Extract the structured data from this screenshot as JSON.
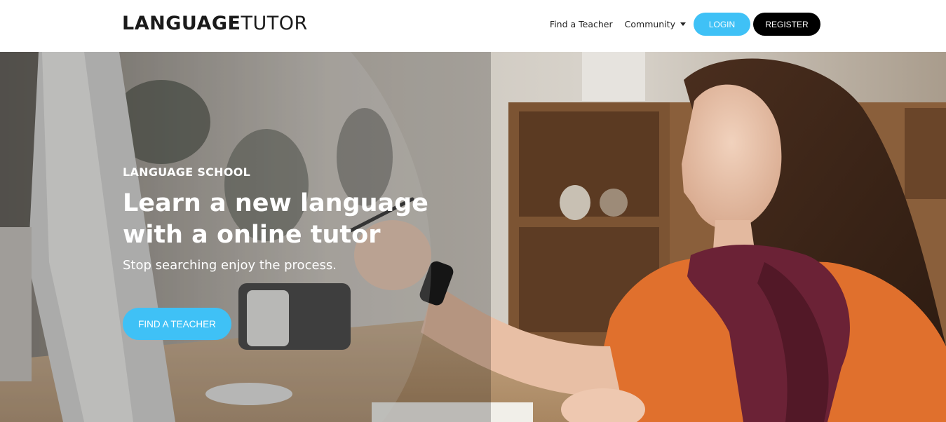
{
  "header": {
    "logo_bold": "LANGUAGE",
    "logo_light": "TUTOR",
    "nav": {
      "find_teacher": "Find a Teacher",
      "community": "Community",
      "login": "LOGIN",
      "register": "REGISTER"
    }
  },
  "hero": {
    "eyebrow": "LANGUAGE SCHOOL",
    "headline_line1": "Learn a new language",
    "headline_line2": "with a online tutor",
    "subtitle": "Stop searching enjoy the process.",
    "cta": "FIND A TEACHER"
  },
  "colors": {
    "accent": "#3fc1f6",
    "dark_button": "#000000",
    "header_bg": "#ffffff"
  },
  "icons": {
    "community_dropdown": "caret-down-icon"
  }
}
